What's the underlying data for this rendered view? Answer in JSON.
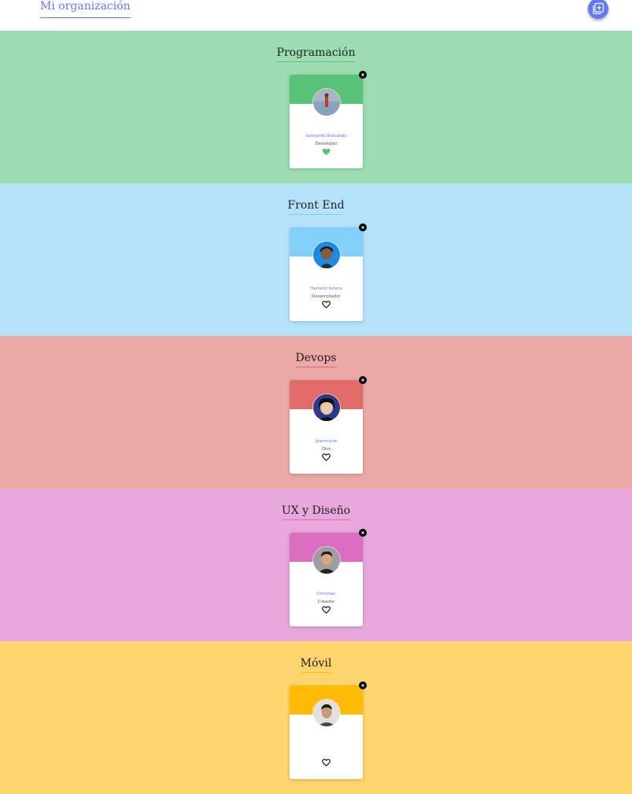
{
  "header": {
    "title": "Mi organización"
  },
  "teams": [
    {
      "name": "Programación",
      "bg": "#9cdcb0",
      "accent": "#57c278",
      "member": {
        "name": "Leonardo Basualdo",
        "role": "Developer",
        "favorite": true
      }
    },
    {
      "name": "Front End",
      "bg": "#b5e2fb",
      "accent": "#82cffa",
      "member": {
        "name": "Harland lohora",
        "role": "Desarrollador",
        "favorite": false
      }
    },
    {
      "name": "Devops",
      "bg": "#eaa8a7",
      "accent": "#e06b69",
      "member": {
        "name": "Jeanmarie",
        "role": "Otro",
        "favorite": false
      }
    },
    {
      "name": "UX y Diseño",
      "bg": "#e8a8db",
      "accent": "#db6ebf",
      "member": {
        "name": "Christian",
        "role": "Creador",
        "favorite": false
      }
    },
    {
      "name": "Móvil",
      "bg": "#fdd56e",
      "accent": "#ffba05",
      "member": {
        "name": "",
        "role": "",
        "favorite": false
      }
    }
  ]
}
